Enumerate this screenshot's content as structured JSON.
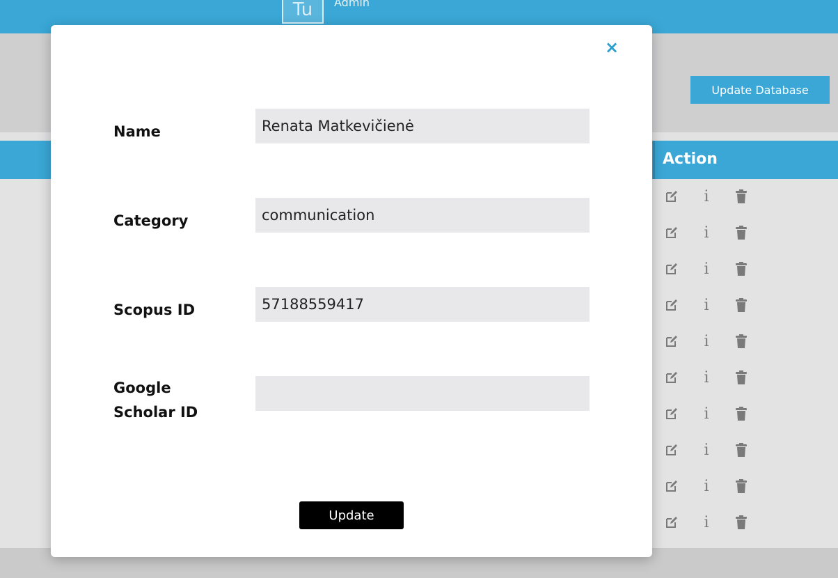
{
  "header": {
    "logo_text": "Tu",
    "user_label": "Admin"
  },
  "toolbar": {
    "update_database_label": "Update Database"
  },
  "table": {
    "action_header": "Action",
    "row_count": 10,
    "info_glyph": "i"
  },
  "modal": {
    "close_glyph": "×",
    "fields": {
      "name": {
        "label": "Name",
        "value": "Renata Matkevičienė"
      },
      "category": {
        "label": "Category",
        "value": "communication"
      },
      "scopus": {
        "label": "Scopus ID",
        "value": "57188559417"
      },
      "scholar": {
        "label_line1": "Google",
        "label_line2": "Scholar ID",
        "value": ""
      }
    },
    "update_label": "Update"
  },
  "colors": {
    "accent": "#3aa7d6",
    "close": "#2a9ed1",
    "input_bg": "#e8e8ea",
    "button": "#000000"
  },
  "icons": {
    "edit": "edit-icon",
    "info": "info-icon",
    "delete": "trash-icon",
    "close": "close-icon"
  }
}
